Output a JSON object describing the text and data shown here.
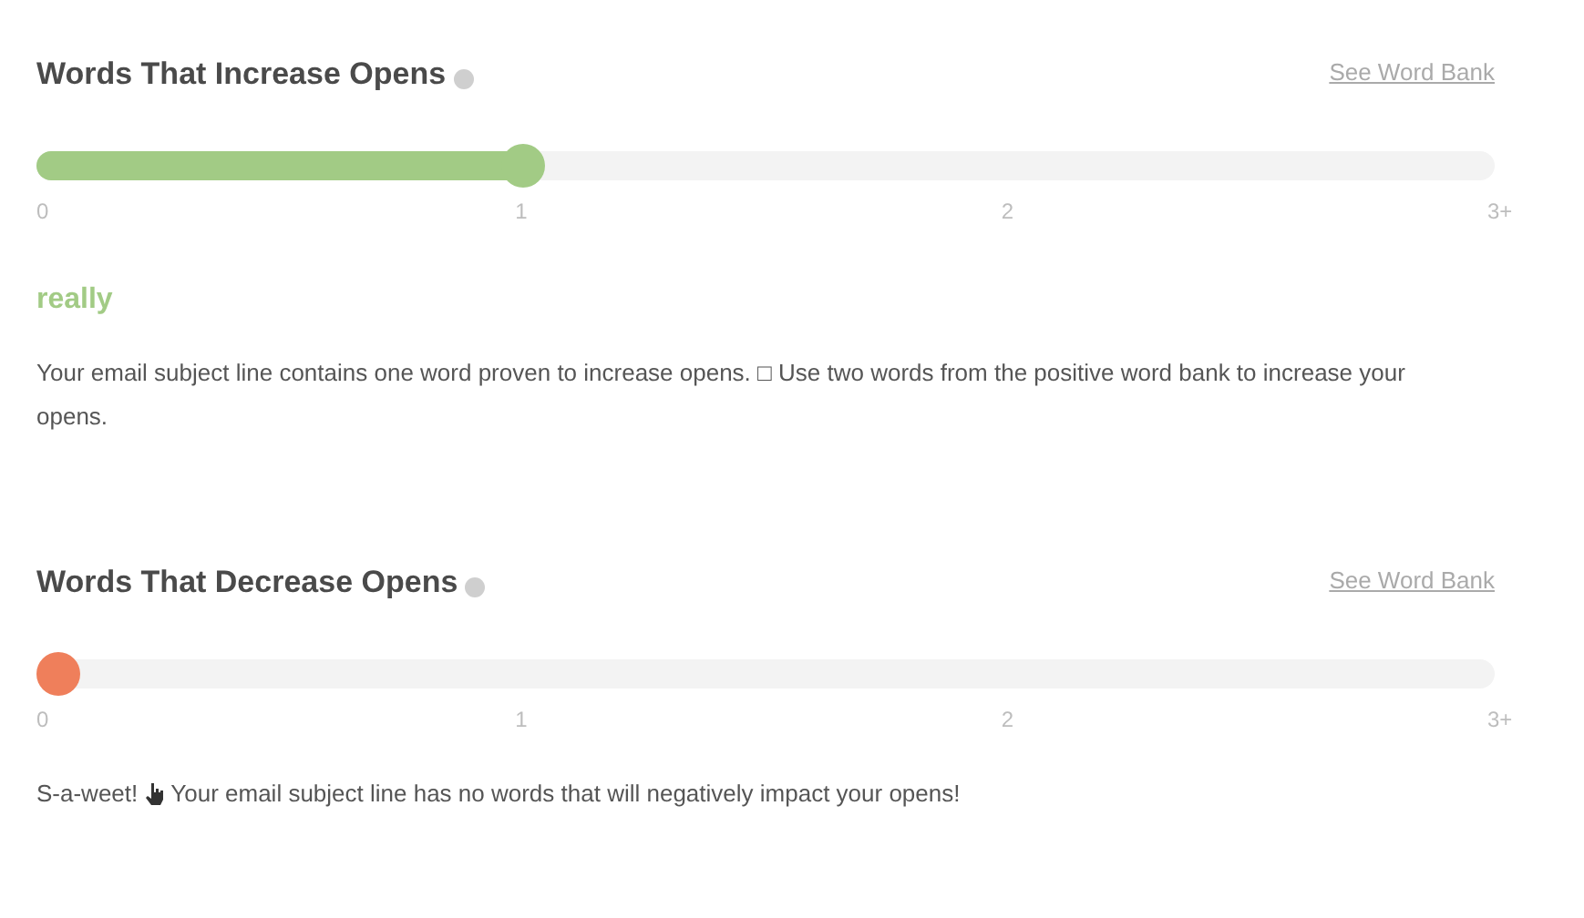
{
  "sections": [
    {
      "title": "Words That Increase Opens",
      "link": "See Word Bank",
      "level": 0.3333,
      "color": "#a2cb85",
      "ticks": [
        "0",
        "1",
        "2",
        "3+"
      ],
      "word": "really",
      "message": "Your email subject line contains one word proven to increase opens. □ Use two words from the positive word bank to increase your opens."
    },
    {
      "title": "Words That Decrease Opens",
      "link": "See Word Bank",
      "level": 0,
      "color": "#ef7f5b",
      "ticks": [
        "0",
        "1",
        "2",
        "3+"
      ],
      "message_before": "S-a-weet!",
      "message_after": "Your email subject line has no words that will negatively impact your opens!"
    }
  ]
}
